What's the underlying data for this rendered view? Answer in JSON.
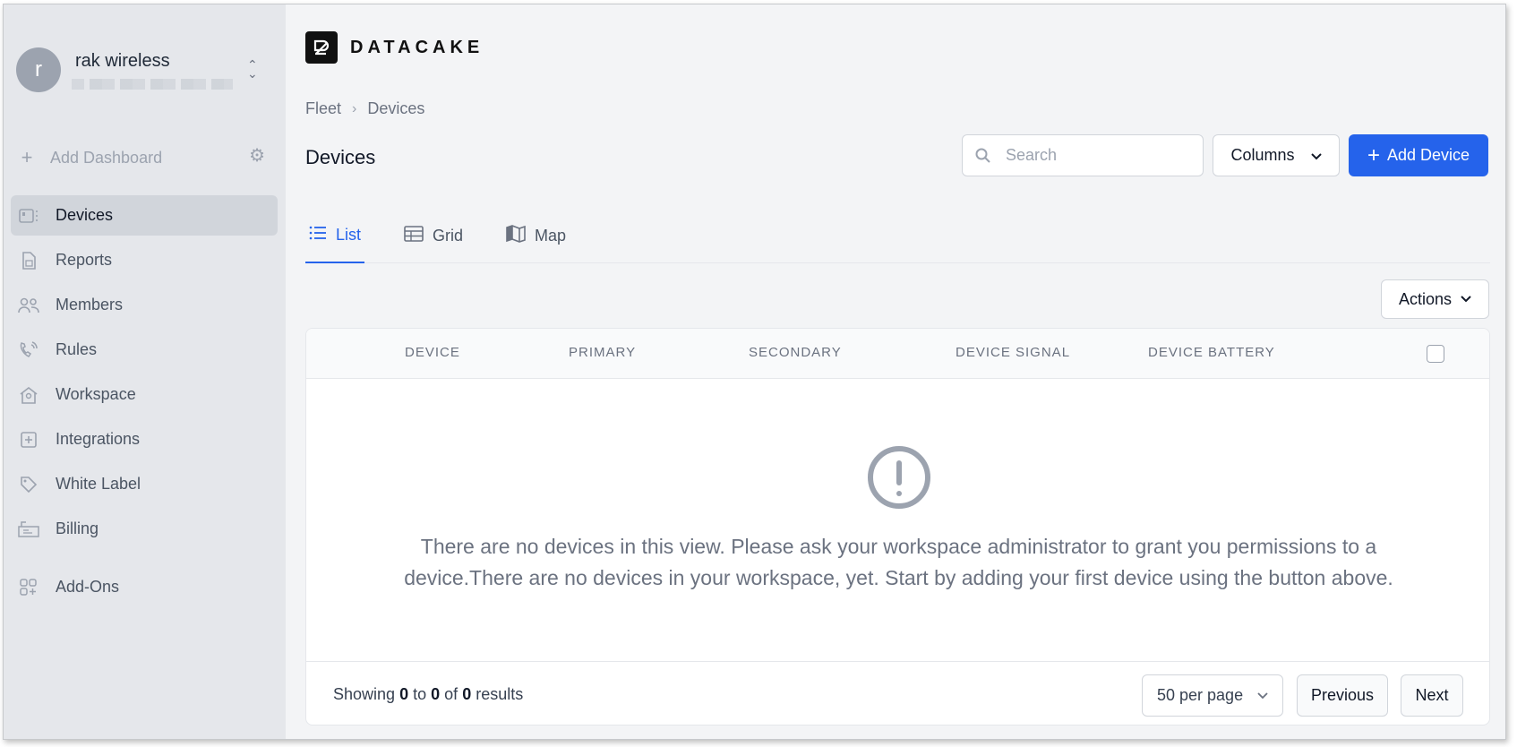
{
  "user": {
    "avatar_letter": "r",
    "name": "rak wireless"
  },
  "sidebar": {
    "add_dashboard": "Add Dashboard",
    "items": [
      {
        "label": "Devices",
        "icon": "device-icon",
        "active": true
      },
      {
        "label": "Reports",
        "icon": "report-icon"
      },
      {
        "label": "Members",
        "icon": "members-icon"
      },
      {
        "label": "Rules",
        "icon": "rules-icon"
      },
      {
        "label": "Workspace",
        "icon": "workspace-icon"
      },
      {
        "label": "Integrations",
        "icon": "integrations-icon"
      },
      {
        "label": "White Label",
        "icon": "tag-icon"
      },
      {
        "label": "Billing",
        "icon": "billing-icon"
      },
      {
        "label": "Add-Ons",
        "icon": "addons-icon"
      }
    ]
  },
  "brand": {
    "logo_text": "DATACAKE"
  },
  "breadcrumb": {
    "parent": "Fleet",
    "current": "Devices"
  },
  "header": {
    "title": "Devices",
    "search_placeholder": "Search",
    "columns_label": "Columns",
    "add_device_label": "Add Device"
  },
  "tabs": [
    {
      "label": "List",
      "icon": "list-icon",
      "active": true
    },
    {
      "label": "Grid",
      "icon": "grid-icon"
    },
    {
      "label": "Map",
      "icon": "map-icon"
    }
  ],
  "actions_label": "Actions",
  "table": {
    "columns": [
      "DEVICE",
      "PRIMARY",
      "SECONDARY",
      "DEVICE SIGNAL",
      "DEVICE BATTERY"
    ],
    "empty_message": "There are no devices in this view. Please ask your workspace administrator to grant you permissions to a device.There are no devices in your workspace, yet. Start by adding your first device using the button above."
  },
  "pagination": {
    "showing_prefix": "Showing",
    "from": "0",
    "to_word": "to",
    "to": "0",
    "of_word": "of",
    "total": "0",
    "results_word": "results",
    "per_page": "50 per page",
    "previous": "Previous",
    "next": "Next"
  },
  "colors": {
    "accent": "#2563eb",
    "sidebar_bg": "#e5e7eb",
    "main_bg": "#f3f4f6"
  }
}
